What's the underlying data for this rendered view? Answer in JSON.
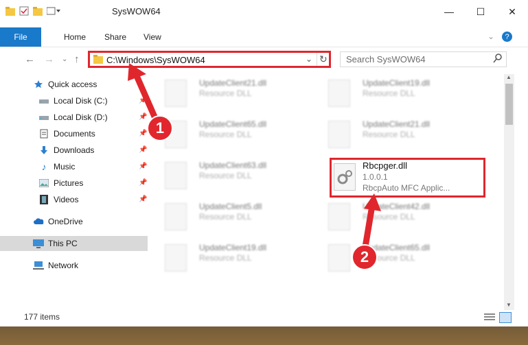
{
  "window": {
    "title": "SysWOW64",
    "controls": {
      "minimize": "—",
      "maximize": "☐",
      "close": "✕"
    }
  },
  "ribbon": {
    "file_tab": "File",
    "tabs": [
      "Home",
      "Share",
      "View"
    ]
  },
  "address_bar": {
    "path": "C:\\Windows\\SysWOW64"
  },
  "search": {
    "placeholder": "Search SysWOW64"
  },
  "sidebar": {
    "items": [
      {
        "label": "Quick access",
        "icon": "star-icon"
      },
      {
        "label": "Local Disk (C:)",
        "icon": "drive-icon"
      },
      {
        "label": "Local Disk (D:)",
        "icon": "drive-icon"
      },
      {
        "label": "Documents",
        "icon": "documents-icon"
      },
      {
        "label": "Downloads",
        "icon": "download-icon"
      },
      {
        "label": "Music",
        "icon": "music-icon"
      },
      {
        "label": "Pictures",
        "icon": "pictures-icon"
      },
      {
        "label": "Videos",
        "icon": "videos-icon"
      },
      {
        "label": "OneDrive",
        "icon": "cloud-icon"
      },
      {
        "label": "This PC",
        "icon": "computer-icon"
      },
      {
        "label": "Network",
        "icon": "network-icon"
      }
    ]
  },
  "files": [
    {
      "name": "UpdateClient21.dll",
      "type": "Resource DLL"
    },
    {
      "name": "UpdateClient19.dll",
      "type": "Resource DLL"
    },
    {
      "name": "UpdateClient65.dll",
      "type": "Resource DLL"
    },
    {
      "name": "UpdateClient21.dll",
      "type": "Resource DLL"
    },
    {
      "name": "UpdateClient63.dll",
      "type": "Resource DLL"
    },
    {
      "name": "UpdateClient5.dll",
      "type": "Resource DLL"
    },
    {
      "name": "UpdateClient42.dll",
      "type": "Resource DLL"
    },
    {
      "name": "UpdateClient19.dll",
      "type": "Resource DLL"
    },
    {
      "name": "UpdateClient65.dll",
      "type": "Resource DLL"
    }
  ],
  "highlighted_file": {
    "name": "Rbcpger.dll",
    "version": "1.0.0.1",
    "description": "RbcpAuto MFC Applic..."
  },
  "status": {
    "item_count": "177 items"
  },
  "callouts": {
    "one": "1",
    "two": "2"
  },
  "colors": {
    "accent": "#1979ca",
    "highlight": "#e0262d"
  }
}
